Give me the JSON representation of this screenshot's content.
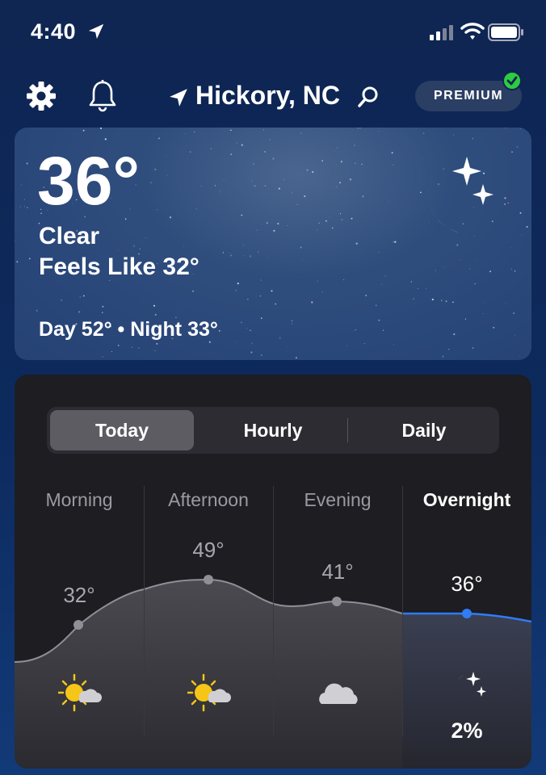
{
  "status_bar": {
    "time": "4:40"
  },
  "header": {
    "location": "Hickory, NC",
    "premium_label": "PREMIUM"
  },
  "current": {
    "temperature": "36°",
    "condition": "Clear",
    "feels_like": "Feels Like 32°",
    "day_night": "Day 52° • Night 33°",
    "icon": "clear-night-icon"
  },
  "forecast": {
    "tabs": [
      {
        "label": "Today",
        "selected": true
      },
      {
        "label": "Hourly",
        "selected": false
      },
      {
        "label": "Daily",
        "selected": false
      }
    ],
    "periods": [
      {
        "label": "Morning",
        "temp": "32°",
        "icon": "partly-sunny-icon",
        "active": false
      },
      {
        "label": "Afternoon",
        "temp": "49°",
        "icon": "partly-sunny-icon",
        "active": false
      },
      {
        "label": "Evening",
        "temp": "41°",
        "icon": "cloudy-icon",
        "active": false
      },
      {
        "label": "Overnight",
        "temp": "36°",
        "icon": "clear-night-icon",
        "precip": "2%",
        "active": true
      }
    ]
  },
  "colors": {
    "background": "#0f2552",
    "card": "#1d1d22",
    "accent_line": "#2f7cf6",
    "sun": "#f5c518",
    "premium_check": "#2ecc40"
  }
}
